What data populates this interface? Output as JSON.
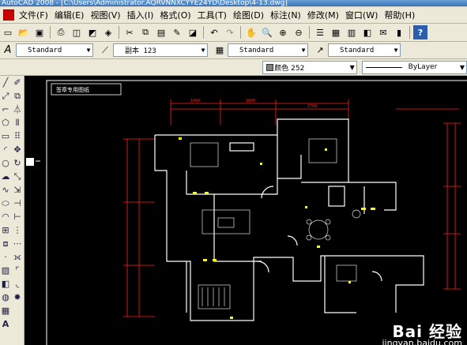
{
  "window": {
    "title": "AutoCAD 2008 - [C:\\Users\\Administrator.AQRVNNXCYYE24YD\\Desktop\\4-13.dwg]"
  },
  "menu": [
    "文件(F)",
    "编辑(E)",
    "视图(V)",
    "插入(I)",
    "格式(O)",
    "工具(T)",
    "绘图(D)",
    "标注(N)",
    "修改(M)",
    "窗口(W)",
    "帮助(H)"
  ],
  "styles": {
    "text_style": "Standard",
    "dim_style": "副本 123",
    "table_style": "Standard",
    "multileader_style": "Standard"
  },
  "properties": {
    "color": "颜色 252",
    "linetype": "ByLayer"
  },
  "drawing": {
    "title_block": "签章专用图纸",
    "colors": {
      "wall": "#ffffff",
      "dim": "#ff2020",
      "hatch": "#ffff00"
    }
  },
  "watermark": {
    "brand": "Bai 经验",
    "url": "jingyan.baidu.com"
  },
  "icons": {
    "toolbar": [
      "new-icon",
      "open-icon",
      "save-icon",
      "plot-icon",
      "preview-icon",
      "publish-icon",
      "3d-dwf-icon",
      "cut-icon",
      "copy-icon",
      "paste-icon",
      "match-properties-icon",
      "block-editor-icon",
      "undo-icon",
      "redo-icon",
      "pan-icon",
      "zoom-realtime-icon",
      "zoom-window-icon",
      "zoom-previous-icon",
      "properties-icon",
      "design-center-icon",
      "tool-palettes-icon",
      "sheet-set-icon",
      "markup-icon",
      "calculator-icon",
      "help-icon"
    ],
    "left_col1": [
      "erase-icon",
      "copy-obj-icon",
      "mirror-icon",
      "offset-icon",
      "array-icon",
      "move-icon",
      "rotate-icon",
      "scale-icon",
      "stretch-icon",
      "trim-icon",
      "extend-icon",
      "break-point-icon",
      "break-icon",
      "join-icon",
      "chamfer-icon",
      "fillet-icon",
      "explode-icon"
    ],
    "left_col2": [
      "line-icon",
      "construction-line-icon",
      "polyline-icon",
      "polygon-icon",
      "rectangle-icon",
      "arc-icon",
      "circle-icon",
      "revcloud-icon",
      "spline-icon",
      "ellipse-icon",
      "ellipse-arc-icon",
      "insert-block-icon",
      "make-block-icon",
      "point-icon",
      "hatch-icon",
      "gradient-icon",
      "region-icon",
      "table-icon",
      "mtext-icon"
    ]
  }
}
